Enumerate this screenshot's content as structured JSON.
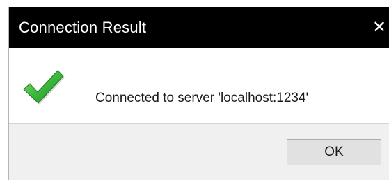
{
  "window": {
    "title": "Connection Result",
    "close_glyph": "✕"
  },
  "content": {
    "icon": "checkmark-icon",
    "icon_color": "#2ea12e",
    "message": "Connected to server 'localhost:1234'"
  },
  "footer": {
    "ok_label": "OK"
  },
  "colors": {
    "titlebar": "#000000",
    "title_text": "#ffffff",
    "footer_bg": "#f0f0f0",
    "button_bg": "#e1e1e1",
    "button_border": "#adadad"
  }
}
